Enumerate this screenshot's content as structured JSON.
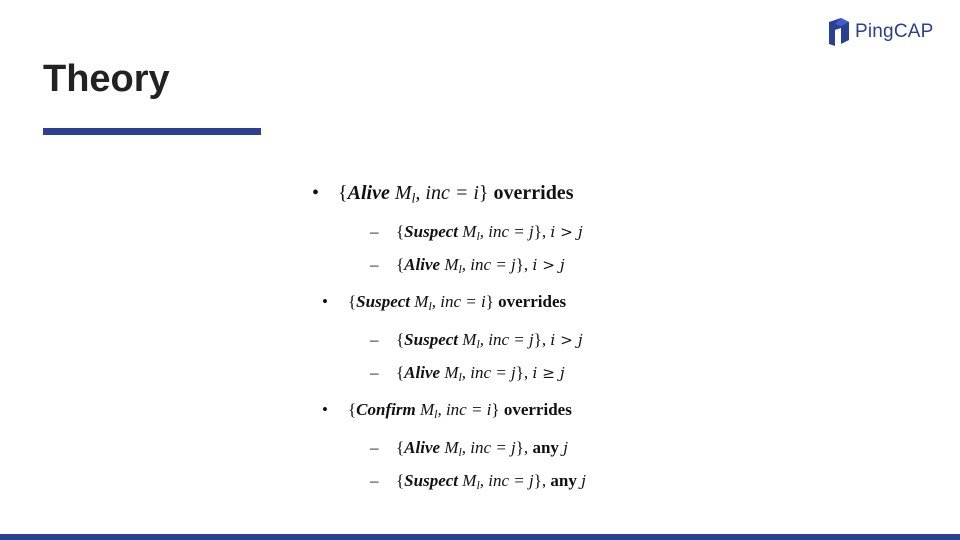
{
  "header": {
    "title": "Theory",
    "logo_text": "PingCAP"
  },
  "colors": {
    "brand": "#2b3f93",
    "logo_light": "#3d5ed6",
    "text": "#222222"
  },
  "rules": [
    {
      "bullet": "•",
      "open": "{",
      "state": "Alive",
      "member": "M",
      "member_sub": "l",
      "inc": ", inc = i",
      "close": "}",
      "verb": "overrides",
      "items": [
        {
          "dash": "–",
          "state": "Suspect",
          "inc": ", inc = j",
          "close": "},",
          "condition": "i > j",
          "condition_prefix": ""
        },
        {
          "dash": "–",
          "state": "Alive",
          "inc": ", inc = j",
          "close": "},",
          "condition": "i > j",
          "condition_prefix": ""
        }
      ]
    },
    {
      "bullet": "•",
      "open": "{",
      "state": "Suspect",
      "member": "M",
      "member_sub": "l",
      "inc": ", inc = i",
      "close": "}",
      "verb": "overrides",
      "items": [
        {
          "dash": "–",
          "state": "Suspect",
          "inc": ", inc = j",
          "close": "},",
          "condition": "i > j",
          "condition_prefix": ""
        },
        {
          "dash": "–",
          "state": "Alive",
          "inc": ", inc = j",
          "close": "},",
          "condition": "i ≥ j",
          "condition_prefix": ""
        }
      ]
    },
    {
      "bullet": "•",
      "open": "{",
      "state": "Confirm",
      "member": "M",
      "member_sub": "l",
      "inc": ", inc = i",
      "close": "}",
      "verb": "overrides",
      "items": [
        {
          "dash": "–",
          "state": "Alive",
          "inc": ", inc = j",
          "close": "},",
          "condition": "j",
          "condition_prefix": "any"
        },
        {
          "dash": "–",
          "state": "Suspect",
          "inc": ", inc = j",
          "close": "},",
          "condition": "j",
          "condition_prefix": "any"
        }
      ]
    }
  ]
}
